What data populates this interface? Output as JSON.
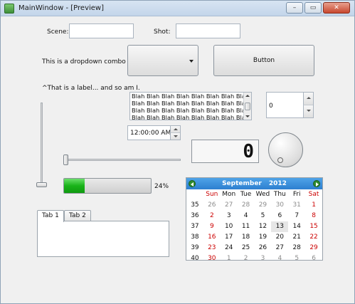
{
  "window": {
    "title": "MainWindow - [Preview]"
  },
  "titlebar_buttons": {
    "minimize": "–",
    "maximize": "▭",
    "close": "✕"
  },
  "form": {
    "scene_label": "Scene:",
    "scene_value": "",
    "shot_label": "Shot:",
    "shot_value": "",
    "combo_label": "This is a dropdown combo =>",
    "combo_value": "",
    "button_label": "Button",
    "caption_label": "^That is a label... and so am I."
  },
  "list": {
    "lines": [
      "Blah Blah Blah Blah Blah Blah Blah Blah",
      "Blah Blah Blah Blah Blah Blah Blah Blah",
      "Blah Blah Blah Blah Blah Blah Blah Blah",
      "Blah Blah Blah Blah Blah Blah Blah Blah"
    ]
  },
  "spinbox": {
    "value": "0"
  },
  "time_edit": {
    "value": "12:00:00 AM"
  },
  "lcd": {
    "value": "0"
  },
  "progress": {
    "percent": 24,
    "label": "24%"
  },
  "tabs": [
    {
      "label": "Tab 1"
    },
    {
      "label": "Tab 2"
    }
  ],
  "calendar": {
    "month": "September",
    "year": "2012",
    "weekdays": [
      "Sun",
      "Mon",
      "Tue",
      "Wed",
      "Thu",
      "Fri",
      "Sat"
    ],
    "weeks": [
      {
        "week": "35",
        "days": [
          "26",
          "27",
          "28",
          "29",
          "30",
          "31",
          "1"
        ],
        "muted": [
          true,
          true,
          true,
          true,
          true,
          true,
          false
        ]
      },
      {
        "week": "36",
        "days": [
          "2",
          "3",
          "4",
          "5",
          "6",
          "7",
          "8"
        ],
        "muted": [
          false,
          false,
          false,
          false,
          false,
          false,
          false
        ]
      },
      {
        "week": "37",
        "days": [
          "9",
          "10",
          "11",
          "12",
          "13",
          "14",
          "15"
        ],
        "muted": [
          false,
          false,
          false,
          false,
          false,
          false,
          false
        ]
      },
      {
        "week": "38",
        "days": [
          "16",
          "17",
          "18",
          "19",
          "20",
          "21",
          "22"
        ],
        "muted": [
          false,
          false,
          false,
          false,
          false,
          false,
          false
        ]
      },
      {
        "week": "39",
        "days": [
          "23",
          "24",
          "25",
          "26",
          "27",
          "28",
          "29"
        ],
        "muted": [
          false,
          false,
          false,
          false,
          false,
          false,
          false
        ]
      },
      {
        "week": "40",
        "days": [
          "30",
          "1",
          "2",
          "3",
          "4",
          "5",
          "6"
        ],
        "muted": [
          false,
          true,
          true,
          true,
          true,
          true,
          true
        ]
      }
    ],
    "today": "13"
  },
  "colors": {
    "accent_blue": "#2d7fd0",
    "progress_green": "#19b319",
    "weekend_red": "#cc0000"
  }
}
